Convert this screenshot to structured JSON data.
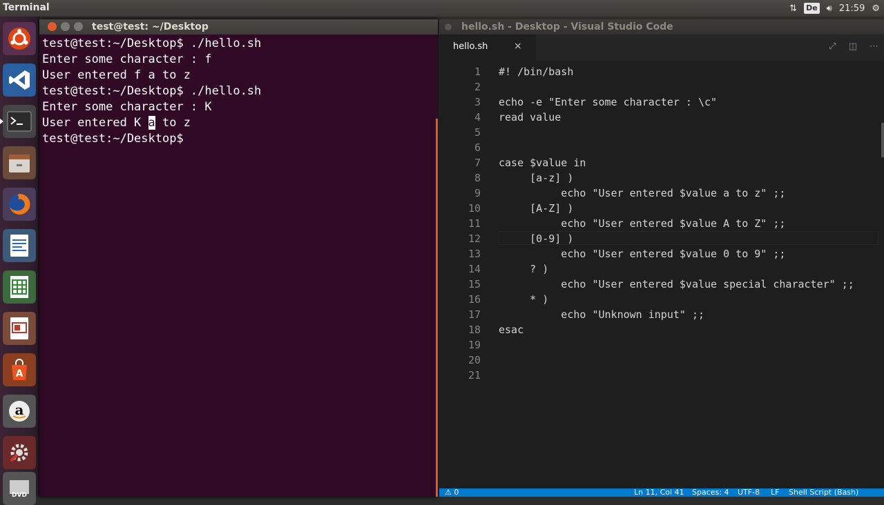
{
  "topbar": {
    "app_title": "Terminal",
    "keyboard_layout": "De",
    "time": "21:59",
    "icons": [
      "network-icon",
      "keyboard-layout-icon",
      "volume-icon",
      "gear-icon"
    ]
  },
  "launcher": {
    "items": [
      "ubuntu-dash-icon",
      "vscode-icon",
      "terminal-icon",
      "files-icon",
      "firefox-icon",
      "writer-icon",
      "calc-icon",
      "impress-icon",
      "software-center-icon",
      "amazon-icon",
      "settings-icon",
      "dvd-icon"
    ]
  },
  "terminal": {
    "title": "test@test: ~/Desktop",
    "lines": [
      "test@test:~/Desktop$ ./hello.sh",
      "Enter some character : f",
      "User entered f a to z",
      "test@test:~/Desktop$ ./hello.sh",
      "Enter some character : K"
    ],
    "line6_before": "User entered K ",
    "line6_cursor": "a",
    "line6_after": " to z",
    "prompt": "test@test:~/Desktop$ "
  },
  "vscode": {
    "title": "hello.sh - Desktop - Visual Studio Code",
    "tab_name": "hello.sh",
    "tab_close": "×",
    "lines": [
      "#! /bin/bash",
      "",
      "echo -e \"Enter some character : \\c\"",
      "read value",
      "",
      "",
      "case $value in",
      "     [a-z] )",
      "          echo \"User entered $value a to z\" ;;",
      "     [A-Z] )",
      "          echo \"User entered $value A to Z\" ;;",
      "     [0-9] )",
      "          echo \"User entered $value 0 to 9\" ;;",
      "     ? )",
      "          echo \"User entered $value special character\" ;;",
      "     * )",
      "          echo \"Unknown input\" ;;",
      "esac",
      "",
      "",
      ""
    ],
    "status": {
      "left": "⚠ 0",
      "position": "Ln 11, Col 41",
      "spaces": "Spaces: 4",
      "encoding": "UTF-8",
      "eol": "LF",
      "language": "Shell Script (Bash)"
    }
  },
  "colors": {
    "terminal_bg": "#300a24",
    "terminal_accent": "#e95420",
    "editor_bg": "#1e1e1e",
    "status_bar": "#007acc"
  }
}
